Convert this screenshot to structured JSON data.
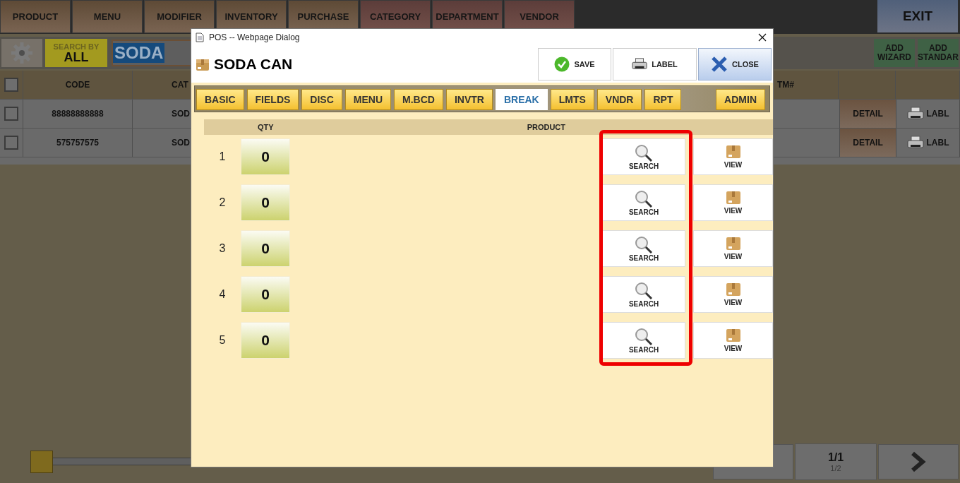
{
  "nav": [
    "PRODUCT",
    "MENU",
    "MODIFIER",
    "INVENTORY",
    "PURCHASE",
    "CATEGORY",
    "DEPARTMENT",
    "VENDOR"
  ],
  "exit": "EXIT",
  "search": {
    "by_label": "SEARCH BY",
    "by_value": "ALL",
    "value": "SODA"
  },
  "add_buttons": [
    {
      "line1": "ADD",
      "line2": "WIZARD"
    },
    {
      "line1": "ADD",
      "line2": "STANDAR"
    }
  ],
  "table": {
    "select_all_checked": false,
    "columns": [
      "CODE",
      "CAT",
      "TM#"
    ],
    "rows": [
      {
        "checked": false,
        "code": "88888888888",
        "column_3": "SOD",
        "detail": "DETAIL",
        "label": "LABL"
      },
      {
        "checked": false,
        "code": "575757575",
        "column_3": "SOD",
        "detail": "DETAIL",
        "label": "LABL"
      }
    ]
  },
  "slider": {
    "level": 0
  },
  "pager": {
    "page": "1/1",
    "sub": "1/2"
  },
  "dialog": {
    "title": "POS -- Webpage Dialog",
    "heading": "SODA CAN",
    "actions": [
      {
        "kind": "save",
        "label": "SAVE"
      },
      {
        "kind": "print",
        "label": "LABEL"
      },
      {
        "kind": "close",
        "label": "CLOSE"
      }
    ],
    "tabs": [
      {
        "label": "BASIC",
        "selected": false
      },
      {
        "label": "FIELDS",
        "selected": false
      },
      {
        "label": "DISC",
        "selected": false
      },
      {
        "label": "MENU",
        "selected": false
      },
      {
        "label": "M.BCD",
        "selected": false
      },
      {
        "label": "INVTR",
        "selected": false
      },
      {
        "label": "BREAK",
        "selected": true
      },
      {
        "label": "LMTS",
        "selected": false
      },
      {
        "label": "VNDR",
        "selected": false
      },
      {
        "label": "RPT",
        "selected": false
      }
    ],
    "admin_tab": {
      "label": "ADMIN",
      "selected": false
    },
    "columns": [
      "QTY",
      "PRODUCT"
    ],
    "rows": [
      {
        "number": "1",
        "qty": "0",
        "search": "SEARCH",
        "view": "VIEW"
      },
      {
        "number": "2",
        "qty": "0",
        "search": "SEARCH",
        "view": "VIEW"
      },
      {
        "number": "3",
        "qty": "0",
        "search": "SEARCH",
        "view": "VIEW"
      },
      {
        "number": "4",
        "qty": "0",
        "search": "SEARCH",
        "view": "VIEW"
      },
      {
        "number": "5",
        "qty": "0",
        "search": "SEARCH",
        "view": "VIEW"
      }
    ]
  }
}
